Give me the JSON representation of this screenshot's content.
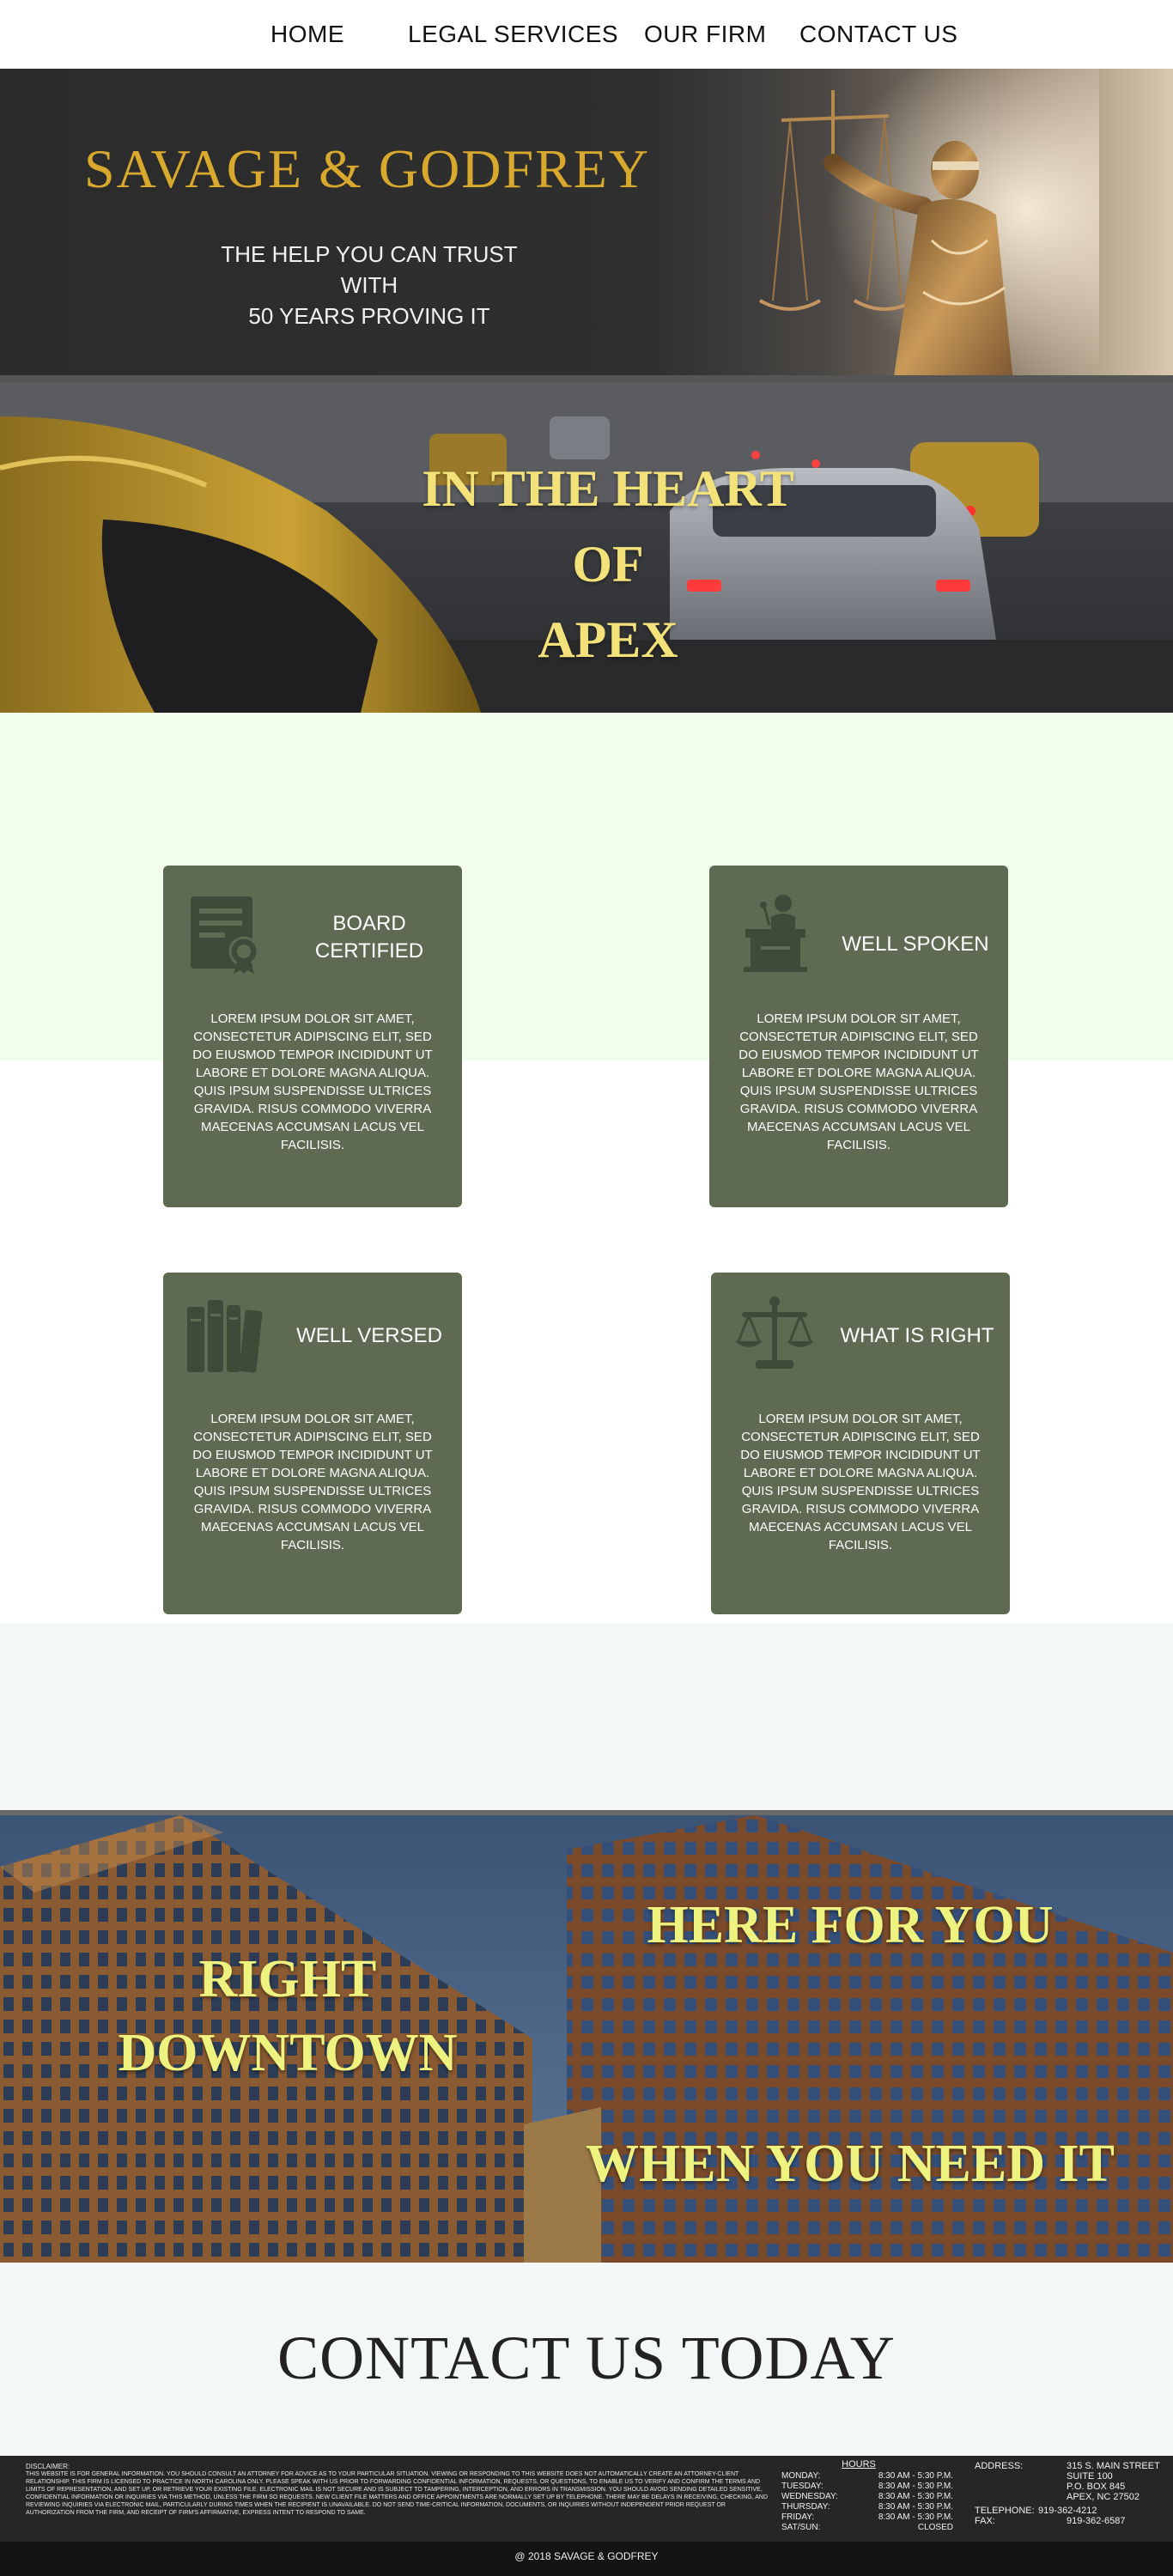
{
  "nav": {
    "items": [
      {
        "label": "HOME"
      },
      {
        "label": "LEGAL SERVICES"
      },
      {
        "label": "OUR FIRM"
      },
      {
        "label": "CONTACT US"
      }
    ]
  },
  "hero": {
    "brand": "SAVAGE & GODFREY",
    "tagline_1": "THE HELP YOU CAN TRUST",
    "tagline_2": "WITH",
    "tagline_3": "50 YEARS PROVING IT",
    "icon": "lady-justice-statue"
  },
  "street": {
    "line_1": "IN THE HEART",
    "line_2": "OF",
    "line_3": "APEX"
  },
  "features": [
    {
      "title_1": "BOARD",
      "title_2": "CERTIFIED",
      "icon": "certificate-icon",
      "body": "LOREM IPSUM DOLOR SIT AMET, CONSECTETUR ADIPISCING ELIT, SED DO EIUSMOD TEMPOR INCIDIDUNT UT LABORE ET DOLORE MAGNA ALIQUA. QUIS IPSUM SUSPENDISSE ULTRICES GRAVIDA. RISUS COMMODO VIVERRA MAECENAS ACCUMSAN LACUS VEL FACILISIS."
    },
    {
      "title_1": "WELL SPOKEN",
      "icon": "podium-icon",
      "body": "LOREM IPSUM DOLOR SIT AMET, CONSECTETUR ADIPISCING ELIT, SED DO EIUSMOD TEMPOR INCIDIDUNT UT LABORE ET DOLORE MAGNA ALIQUA. QUIS IPSUM SUSPENDISSE ULTRICES GRAVIDA. RISUS COMMODO VIVERRA MAECENAS ACCUMSAN LACUS VEL FACILISIS."
    },
    {
      "title_1": "WELL VERSED",
      "icon": "books-icon",
      "body": "LOREM IPSUM DOLOR SIT AMET, CONSECTETUR ADIPISCING ELIT, SED DO EIUSMOD TEMPOR INCIDIDUNT UT LABORE ET DOLORE MAGNA ALIQUA. QUIS IPSUM SUSPENDISSE ULTRICES GRAVIDA. RISUS COMMODO VIVERRA MAECENAS ACCUMSAN LACUS VEL FACILISIS."
    },
    {
      "title_1": "WHAT IS RIGHT",
      "icon": "scales-icon",
      "body": "LOREM IPSUM DOLOR SIT AMET, CONSECTETUR ADIPISCING ELIT, SED DO EIUSMOD TEMPOR INCIDIDUNT UT LABORE ET DOLORE MAGNA ALIQUA. QUIS IPSUM SUSPENDISSE ULTRICES GRAVIDA. RISUS COMMODO VIVERRA MAECENAS ACCUMSAN LACUS VEL FACILISIS."
    }
  ],
  "downtown": {
    "right_1": "RIGHT",
    "right_2": "DOWNTOWN",
    "here": "HERE FOR YOU",
    "when": "WHEN YOU NEED IT"
  },
  "contact": {
    "title": "CONTACT US TODAY"
  },
  "footer": {
    "disclaimer_title": "DISCLAIMER:",
    "disclaimer_text": "THIS WEBSITE IS FOR GENERAL INFORMATION. YOU SHOULD CONSULT AN ATTORNEY FOR ADVICE AS TO YOUR PARTICULAR SITUATION. VIEWING OR RESPONDING TO THIS WEBSITE DOES NOT AUTOMATICALLY CREATE AN ATTORNEY-CLIENT RELATIONSHIP. THIS FIRM IS LICENSED TO PRACTICE IN NORTH CAROLINA ONLY. PLEASE SPEAK WITH US PRIOR TO FORWARDING CONFIDENTIAL INFORMATION, REQUESTS, OR QUESTIONS, TO ENABLE US TO VERIFY AND CONFIRM THE TERMS AND LIMITS OF REPRESENTATION, AND SET UP, OR RETRIEVE YOUR EXISTING FILE. ELECTRONIC MAIL IS NOT SECURE AND IS SUBJECT TO TAMPERING, INTERCEPTION, AND ERRORS IN TRANSMISSION. YOU SHOULD AVOID SENDING DETAILED SENSITIVE, CONFIDENTIAL INFORMATION OR INQUIRIES VIA THIS METHOD, UNLESS THE FIRM SO REQUESTS. NEW CLIENT FILE MATTERS AND OFFICE APPOINTMENTS ARE NORMALLY SET UP BY TELEPHONE. THERE MAY BE DELAYS IN RECEIVING, CHECKING, AND REVIEWING INQUIRIES VIA ELECTRONIC MAIL, PARTICULARLY DURING TIMES WHEN THE RECIPIENT IS UNAVAILABLE. DO NOT SEND TIME-CRITICAL INFORMATION, DOCUMENTS, OR INQUIRIES WITHOUT INDEPENDENT PRIOR REQUEST OR AUTHORIZATION FROM THE FIRM, AND RECEIPT OF FIRM'S AFFIRMATIVE, EXPRESS INTENT TO RESPOND TO SAME.",
    "hours_title": "HOURS",
    "hours": [
      {
        "day": "MONDAY:",
        "time": "8:30 AM - 5:30 P.M."
      },
      {
        "day": "TUESDAY:",
        "time": "8:30 AM - 5:30 P.M."
      },
      {
        "day": "WEDNESDAY:",
        "time": "8:30 AM - 5:30 P.M."
      },
      {
        "day": "THURSDAY:",
        "time": "8:30 AM - 5:30 P.M."
      },
      {
        "day": "FRIDAY:",
        "time": "8:30 AM - 5:30 P.M."
      },
      {
        "day": "SAT/SUN:",
        "time": "CLOSED"
      }
    ],
    "address_label": "ADDRESS:",
    "address_lines": [
      "315 S. MAIN STREET",
      "SUITE 100",
      "P.O. BOX 845",
      "APEX, NC 27502"
    ],
    "telephone_label": "TELEPHONE:",
    "telephone": "919-362-4212",
    "fax_label": "FAX:",
    "fax": "919-362-6587",
    "copyright": "@ 2018 SAVAGE & GODFREY"
  }
}
